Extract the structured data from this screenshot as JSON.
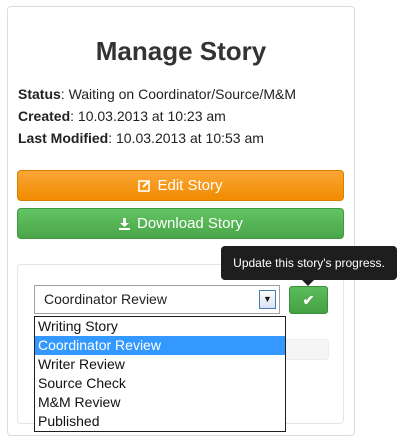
{
  "page": {
    "title": "Manage Story"
  },
  "meta": {
    "status_label": "Status",
    "status_value": ": Waiting on Coordinator/Source/M&M",
    "created_label": "Created",
    "created_value": ": 10.03.2013 at 10:23 am",
    "modified_label": "Last Modified",
    "modified_value": ": 10.03.2013 at 10:53 am"
  },
  "buttons": {
    "edit_label": "Edit Story",
    "edit_icon": "edit-icon",
    "download_label": "Download Story",
    "download_icon": "download-icon"
  },
  "progress": {
    "selected": "Coordinator Review",
    "options": [
      "Writing Story",
      "Coordinator Review",
      "Writer Review",
      "Source Check",
      "M&M Review",
      "Published"
    ],
    "selected_index": 1,
    "confirm_icon": "check-icon",
    "tooltip": "Update this story's progress."
  },
  "colors": {
    "edit": "#f5960e",
    "download": "#51ad51",
    "confirm": "#4cad4c",
    "selection": "#3399ff",
    "tooltip_bg": "#1e1e1e"
  }
}
